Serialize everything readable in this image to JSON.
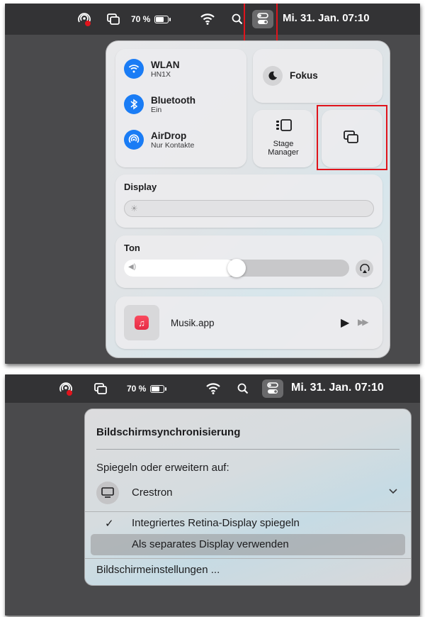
{
  "menubar": {
    "battery_percent": "70 %",
    "datetime": "Mi. 31. Jan.  07:10",
    "icons": [
      "airplay-recording-icon",
      "screen-mirroring-icon",
      "battery-icon",
      "wifi-icon",
      "spotlight-search-icon",
      "control-center-icon"
    ]
  },
  "control_center": {
    "network": [
      {
        "title": "WLAN",
        "subtitle": "HN1X",
        "icon": "wifi-icon"
      },
      {
        "title": "Bluetooth",
        "subtitle": "Ein",
        "icon": "bluetooth-icon"
      },
      {
        "title": "AirDrop",
        "subtitle": "Nur Kontakte",
        "icon": "airdrop-icon"
      }
    ],
    "focus_label": "Fokus",
    "stage_manager_label_1": "Stage",
    "stage_manager_label_2": "Manager",
    "display_title": "Display",
    "display_level": 0.0,
    "sound_title": "Ton",
    "sound_level": 0.45,
    "music_app": "Musik.app"
  },
  "mirroring_menu": {
    "title": "Bildschirmsynchronisierung",
    "section_label": "Spiegeln oder erweitern auf:",
    "device": "Crestron",
    "options": [
      {
        "label": "Integriertes Retina-Display spiegeln",
        "checked": true
      },
      {
        "label": "Als separates Display verwenden",
        "checked": false
      }
    ],
    "settings_link": "Bildschirmeinstellungen ..."
  },
  "colors": {
    "accent_blue": "#1a7cf5",
    "highlight_red": "#e0141c",
    "menubar": "#333335"
  }
}
